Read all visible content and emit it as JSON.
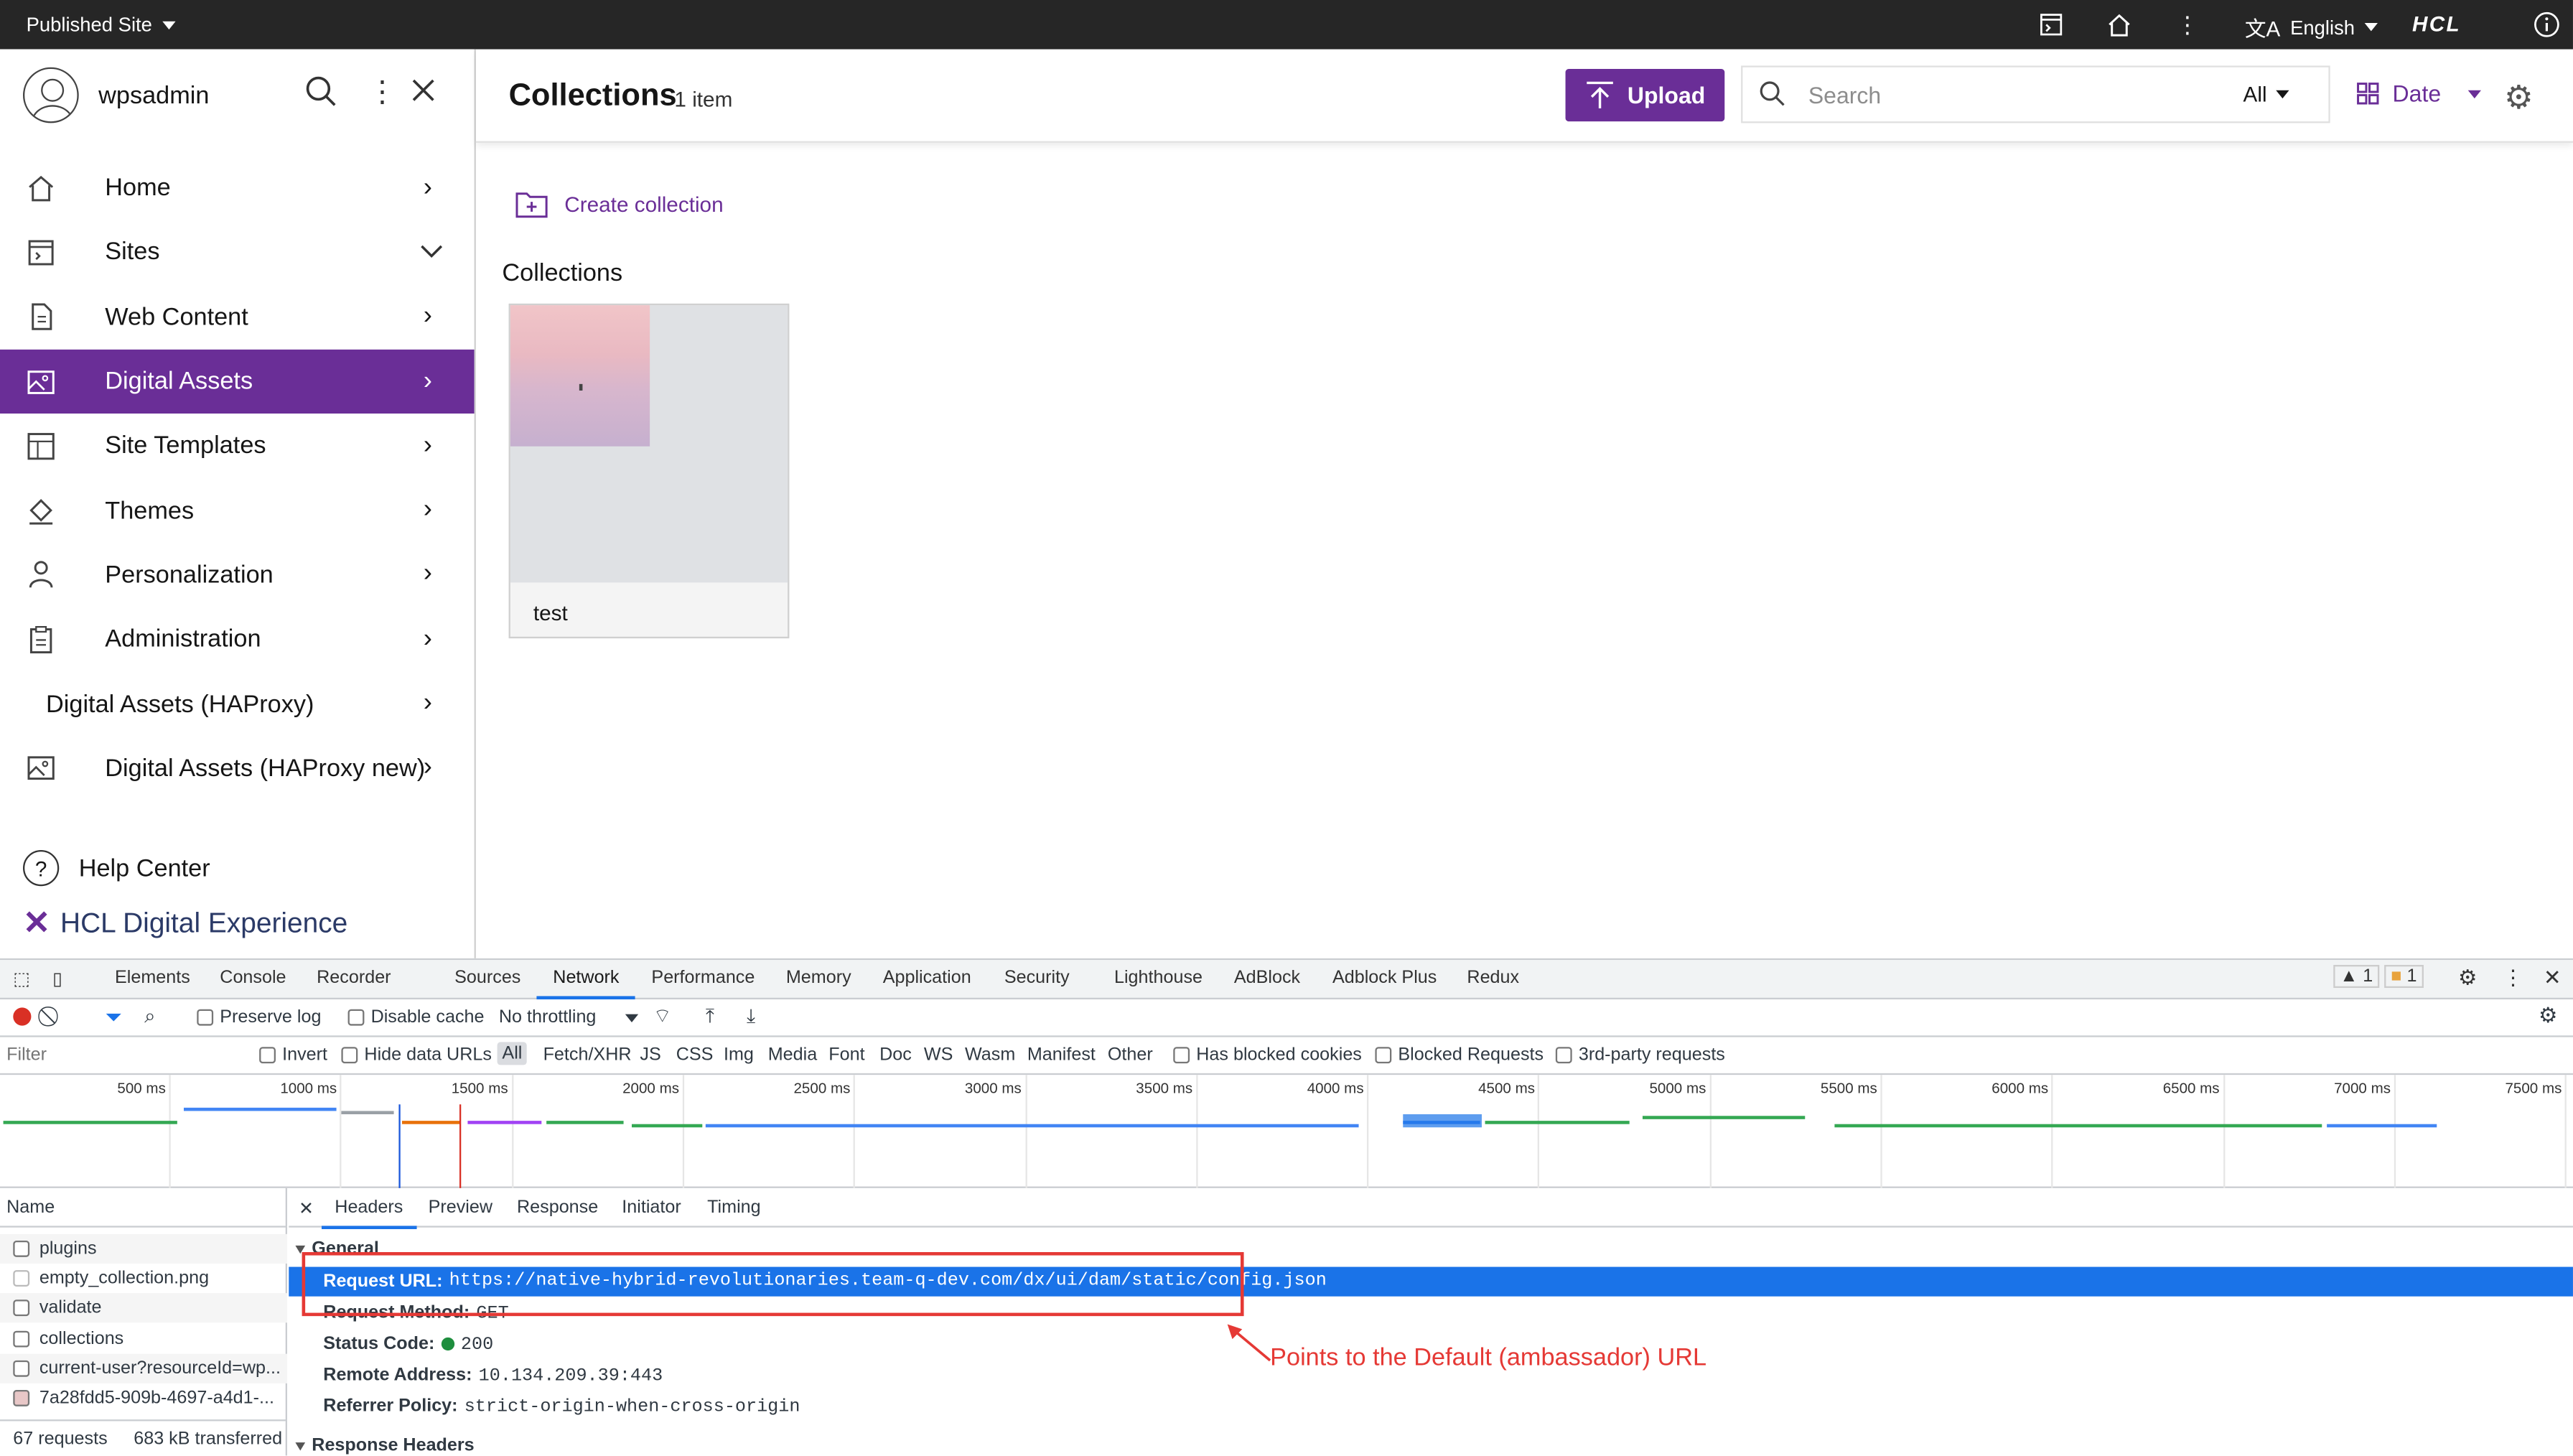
{
  "topbar": {
    "site_label": "Published Site",
    "language": "English",
    "brand": "HCL"
  },
  "sidebar": {
    "username": "wpsadmin",
    "items": [
      {
        "label": "Home",
        "icon": "home-icon",
        "chev": "›"
      },
      {
        "label": "Sites",
        "icon": "sites-icon",
        "chev": "⌄"
      },
      {
        "label": "Web Content",
        "icon": "document-icon",
        "chev": "›"
      },
      {
        "label": "Digital Assets",
        "icon": "image-icon",
        "chev": "›"
      },
      {
        "label": "Site Templates",
        "icon": "template-icon",
        "chev": "›"
      },
      {
        "label": "Themes",
        "icon": "paint-bucket-icon",
        "chev": "›"
      },
      {
        "label": "Personalization",
        "icon": "person-icon",
        "chev": "›"
      },
      {
        "label": "Administration",
        "icon": "clipboard-icon",
        "chev": "›"
      },
      {
        "label": "Digital Assets (HAProxy)",
        "icon": "",
        "chev": "›"
      },
      {
        "label": "Digital Assets (HAProxy new)",
        "icon": "image-icon",
        "chev": "›"
      }
    ],
    "help_label": "Help Center",
    "brand_label": "HCL Digital Experience"
  },
  "main": {
    "title": "Collections",
    "count": "1 item",
    "upload_label": "Upload",
    "search_placeholder": "Search",
    "search_scope": "All",
    "sort_label": "Date",
    "create_label": "Create collection",
    "section_title": "Collections",
    "cards": [
      {
        "name": "test"
      }
    ]
  },
  "devtools": {
    "tabs": [
      "Elements",
      "Console",
      "Recorder",
      "Sources",
      "Network",
      "Performance",
      "Memory",
      "Application",
      "Security",
      "Lighthouse",
      "AdBlock",
      "Adblock Plus",
      "Redux"
    ],
    "active_tab": "Network",
    "warn_count": "1",
    "issue_count": "1",
    "toolbar": {
      "preserve_log": "Preserve log",
      "disable_cache": "Disable cache",
      "throttling": "No throttling"
    },
    "filter": {
      "placeholder": "Filter",
      "invert": "Invert",
      "hide_data_urls": "Hide data URLs",
      "types": [
        "All",
        "Fetch/XHR",
        "JS",
        "CSS",
        "Img",
        "Media",
        "Font",
        "Doc",
        "WS",
        "Wasm",
        "Manifest",
        "Other"
      ],
      "has_blocked_cookies": "Has blocked cookies",
      "blocked_requests": "Blocked Requests",
      "third_party": "3rd-party requests"
    },
    "timeline_labels": [
      "500 ms",
      "1000 ms",
      "1500 ms",
      "2000 ms",
      "2500 ms",
      "3000 ms",
      "3500 ms",
      "4000 ms",
      "4500 ms",
      "5000 ms",
      "5500 ms",
      "6000 ms",
      "6500 ms",
      "7000 ms",
      "7500 ms"
    ],
    "requests": {
      "header": "Name",
      "rows": [
        "plugins",
        "empty_collection.png",
        "validate",
        "collections",
        "current-user?resourceId=wp...",
        "7a28fdd5-909b-4697-a4d1-..."
      ],
      "footer_requests": "67 requests",
      "footer_transferred": "683 kB transferred"
    },
    "detail_tabs": [
      "Headers",
      "Preview",
      "Response",
      "Initiator",
      "Timing"
    ],
    "general": {
      "section": "General",
      "request_url_key": "Request URL:",
      "request_url": "https://native-hybrid-revolutionaries.team-q-dev.com/dx/ui/dam/static/config.json",
      "method_key": "Request Method:",
      "method": "GET",
      "status_key": "Status Code:",
      "status": "200",
      "remote_key": "Remote Address:",
      "remote": "10.134.209.39:443",
      "referrer_key": "Referrer Policy:",
      "referrer": "strict-origin-when-cross-origin"
    },
    "response_headers_label": "Response Headers"
  },
  "annotation": "Points to the Default (ambassador) URL",
  "colors": {
    "accent": "#6a2e97",
    "devtools_blue": "#1a73e8",
    "annotation_red": "#e53935"
  }
}
